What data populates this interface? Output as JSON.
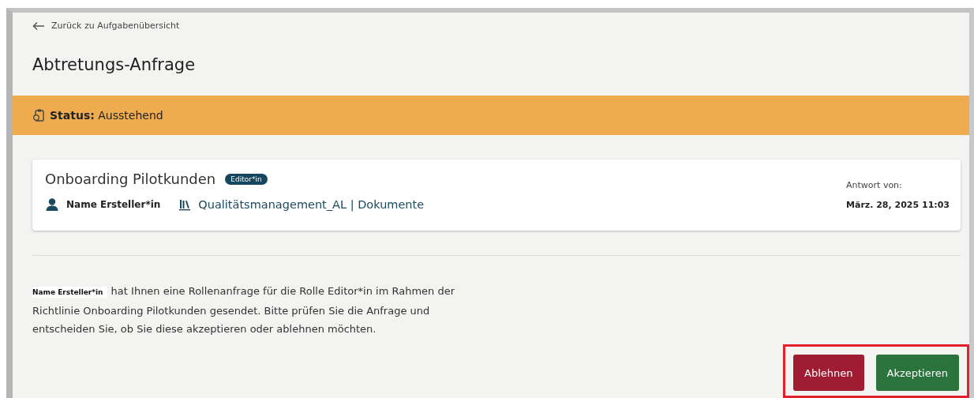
{
  "back_link": {
    "label": "Zurück zu Aufgabenübersicht"
  },
  "page_title": "Abtretungs-Anfrage",
  "status": {
    "label": "Status:",
    "value": "Ausstehend"
  },
  "card": {
    "title": "Onboarding Pilotkunden",
    "badge": "Editor*in",
    "creator": "Name Ersteller*in",
    "link": "Qualitätsmanagement_AL | Dokumente",
    "response_label": "Antwort von:",
    "response_date": "März. 28, 2025 11:03"
  },
  "message": {
    "sender": "Name Ersteller*in",
    "text": "hat Ihnen eine Rollenanfrage für die Rolle Editor*in im Rahmen der Richtlinie Onboarding Pilotkunden gesendet. Bitte prüfen Sie die Anfrage und entscheiden Sie, ob Sie diese akzeptieren oder ablehnen möchten."
  },
  "buttons": [
    {
      "label": "Ablehnen",
      "kind": "reject"
    },
    {
      "label": "Akzeptieren",
      "kind": "accept"
    }
  ],
  "highlight": {
    "on": true
  }
}
